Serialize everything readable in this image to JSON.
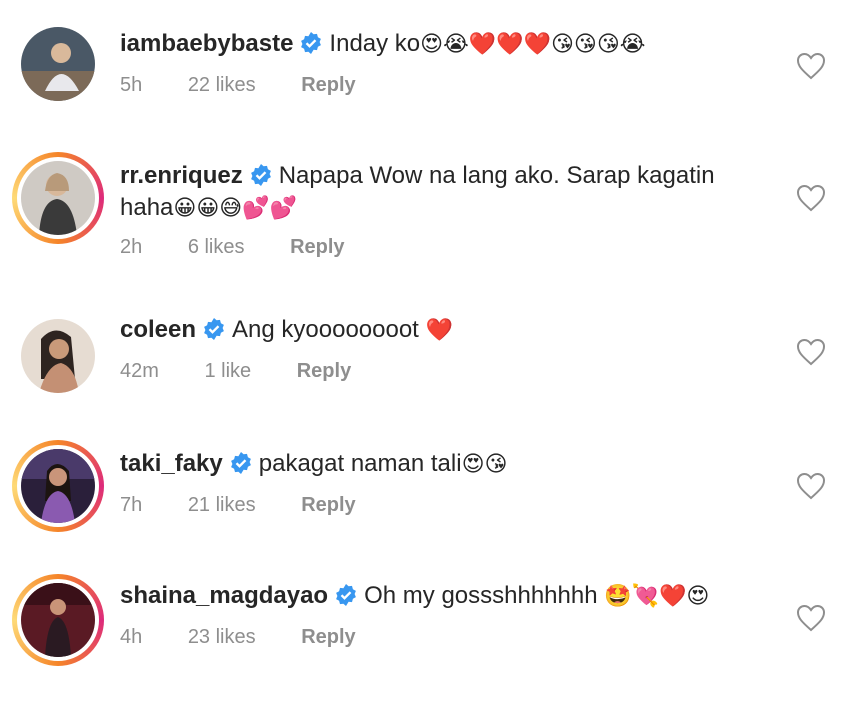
{
  "comments": [
    {
      "username": "iambaebybaste",
      "text": "Inday ko",
      "emojis": "😍😭❤️❤️❤️😘😘😘😭",
      "time": "5h",
      "likes": "22 likes",
      "reply": "Reply",
      "story_ring": false,
      "avatar_color": "#5a6b7d"
    },
    {
      "username": "rr.enriquez",
      "text": "Napapa Wow na lang ako. Sarap kagatin",
      "text2": "haha",
      "emojis": "😀😀😅💕💕",
      "time": "2h",
      "likes": "6 likes",
      "reply": "Reply",
      "story_ring": true,
      "avatar_color": "#c9b8a8"
    },
    {
      "username": "coleen",
      "text": "Ang kyoooooooot",
      "emojis": "❤️",
      "time": "42m",
      "likes": "1 like",
      "reply": "Reply",
      "story_ring": false,
      "avatar_color": "#b89a84"
    },
    {
      "username": "taki_faky",
      "text": "pakagat naman tali",
      "emojis": "😍😘",
      "time": "7h",
      "likes": "21 likes",
      "reply": "Reply",
      "story_ring": true,
      "avatar_color": "#6b3f7a"
    },
    {
      "username": "shaina_magdayao",
      "text": "Oh my gossshhhhhhh",
      "emojis": "🤩💘❤️😍",
      "time": "4h",
      "likes": "23 likes",
      "reply": "Reply",
      "story_ring": true,
      "avatar_color": "#7a2a3a"
    }
  ],
  "colors": {
    "verified_badge": "#3897f0",
    "meta_text": "#8e8e8e",
    "story_ring_start": "#f58529",
    "story_ring_end": "#dd2a7b"
  }
}
